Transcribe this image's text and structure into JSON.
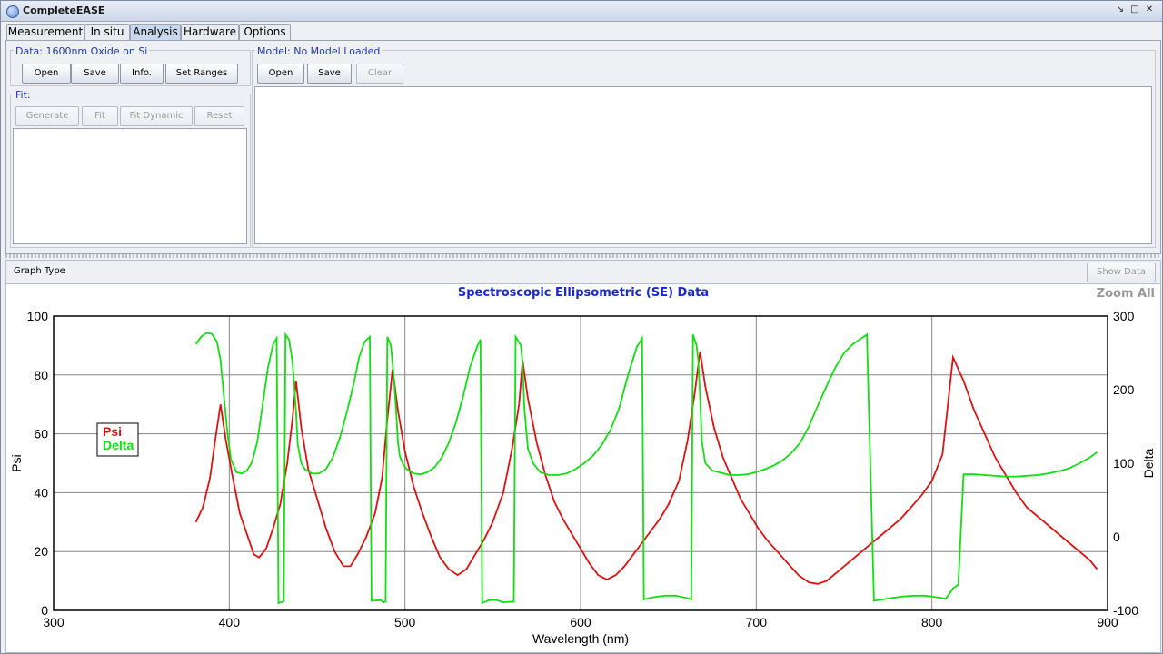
{
  "window": {
    "title": "CompleteEASE"
  },
  "tabs": [
    {
      "label": "Measurement",
      "active": false
    },
    {
      "label": "In situ",
      "active": false
    },
    {
      "label": "Analysis",
      "active": true
    },
    {
      "label": "Hardware",
      "active": false
    },
    {
      "label": "Options",
      "active": false
    }
  ],
  "data_group": {
    "title": "Data: 1600nm Oxide on Si",
    "buttons": {
      "open": "Open",
      "save": "Save",
      "info": "Info.",
      "set_ranges": "Set Ranges"
    }
  },
  "fit_group": {
    "title": "Fit:",
    "buttons": {
      "generate": "Generate",
      "fit": "Fit",
      "fit_dynamic": "Fit Dynamic",
      "reset": "Reset"
    }
  },
  "model_group": {
    "title": "Model: No Model Loaded",
    "buttons": {
      "open": "Open",
      "save": "Save",
      "clear": "Clear"
    }
  },
  "graph_bar": {
    "graph_type_label": "Graph Type",
    "show_data": "Show Data"
  },
  "graph": {
    "zoom_all": "Zoom All"
  },
  "colors": {
    "psi": "#e01010",
    "delta": "#10e010",
    "title": "#1a2ad0"
  },
  "chart_data": {
    "type": "line",
    "title": "Spectroscopic Ellipsometric (SE) Data",
    "xlabel": "Wavelength (nm)",
    "ylabel": "Psi",
    "y2label": "Delta",
    "xlim": [
      300,
      900
    ],
    "ylim": [
      0,
      100
    ],
    "y2lim": [
      -100,
      300
    ],
    "xticks": [
      "300",
      "400",
      "500",
      "600",
      "700",
      "800",
      "900"
    ],
    "yticks": [
      "0",
      "20",
      "40",
      "60",
      "80",
      "100"
    ],
    "y2ticks": [
      "-100",
      "0",
      "100",
      "200",
      "300"
    ],
    "grid": true,
    "legend_position": "left",
    "series": [
      {
        "name": "Psi",
        "axis": "left",
        "color": "#e01010",
        "points": [
          [
            381,
            30
          ],
          [
            385,
            35
          ],
          [
            389,
            45
          ],
          [
            392,
            58
          ],
          [
            395,
            70
          ],
          [
            398,
            58
          ],
          [
            402,
            45
          ],
          [
            406,
            33
          ],
          [
            410,
            26
          ],
          [
            414,
            19
          ],
          [
            417,
            18
          ],
          [
            421,
            21
          ],
          [
            425,
            28
          ],
          [
            429,
            36
          ],
          [
            433,
            50
          ],
          [
            436,
            65
          ],
          [
            438,
            78
          ],
          [
            441,
            62
          ],
          [
            445,
            48
          ],
          [
            450,
            38
          ],
          [
            455,
            28
          ],
          [
            460,
            20
          ],
          [
            465,
            15
          ],
          [
            469,
            15
          ],
          [
            473,
            19
          ],
          [
            478,
            25
          ],
          [
            483,
            33
          ],
          [
            487,
            45
          ],
          [
            490,
            65
          ],
          [
            493,
            82
          ],
          [
            496,
            68
          ],
          [
            500,
            54
          ],
          [
            505,
            42
          ],
          [
            510,
            33
          ],
          [
            515,
            25
          ],
          [
            520,
            18
          ],
          [
            525,
            14
          ],
          [
            530,
            12
          ],
          [
            535,
            14
          ],
          [
            540,
            19
          ],
          [
            545,
            24
          ],
          [
            550,
            30
          ],
          [
            556,
            40
          ],
          [
            561,
            55
          ],
          [
            565,
            70
          ],
          [
            567,
            85
          ],
          [
            570,
            72
          ],
          [
            575,
            57
          ],
          [
            580,
            46
          ],
          [
            585,
            37
          ],
          [
            590,
            31
          ],
          [
            595,
            26
          ],
          [
            600,
            21
          ],
          [
            605,
            16
          ],
          [
            610,
            12
          ],
          [
            615,
            10.5
          ],
          [
            620,
            12
          ],
          [
            625,
            15
          ],
          [
            630,
            19
          ],
          [
            635,
            23
          ],
          [
            640,
            27
          ],
          [
            645,
            31
          ],
          [
            650,
            36
          ],
          [
            656,
            44
          ],
          [
            661,
            58
          ],
          [
            665,
            74
          ],
          [
            668,
            88
          ],
          [
            671,
            76
          ],
          [
            676,
            62
          ],
          [
            681,
            52
          ],
          [
            686,
            45
          ],
          [
            691,
            38
          ],
          [
            696,
            33
          ],
          [
            701,
            28
          ],
          [
            706,
            24
          ],
          [
            712,
            20
          ],
          [
            718,
            16
          ],
          [
            724,
            12
          ],
          [
            730,
            9.5
          ],
          [
            735,
            9
          ],
          [
            740,
            10
          ],
          [
            746,
            13
          ],
          [
            752,
            16
          ],
          [
            758,
            19
          ],
          [
            764,
            22
          ],
          [
            770,
            25
          ],
          [
            776,
            28
          ],
          [
            782,
            31
          ],
          [
            788,
            35
          ],
          [
            794,
            39
          ],
          [
            800,
            44
          ],
          [
            806,
            53
          ],
          [
            812,
            86
          ],
          [
            818,
            78
          ],
          [
            824,
            68
          ],
          [
            830,
            60
          ],
          [
            836,
            52
          ],
          [
            842,
            46
          ],
          [
            848,
            40
          ],
          [
            854,
            35
          ],
          [
            860,
            32
          ],
          [
            866,
            29
          ],
          [
            872,
            26
          ],
          [
            878,
            23
          ],
          [
            884,
            20
          ],
          [
            890,
            17
          ],
          [
            894,
            14
          ]
        ]
      },
      {
        "name": "Delta",
        "axis": "right",
        "color": "#10e010",
        "points": [
          [
            381,
            262
          ],
          [
            384,
            272
          ],
          [
            387,
            277
          ],
          [
            390,
            276
          ],
          [
            393,
            265
          ],
          [
            395,
            240
          ],
          [
            397,
            190
          ],
          [
            399,
            140
          ],
          [
            401,
            105
          ],
          [
            404,
            88
          ],
          [
            407,
            86
          ],
          [
            410,
            90
          ],
          [
            413,
            102
          ],
          [
            416,
            130
          ],
          [
            419,
            180
          ],
          [
            422,
            230
          ],
          [
            425,
            262
          ],
          [
            427,
            270
          ],
          [
            428,
            -90
          ],
          [
            431,
            -88
          ],
          [
            432,
            275
          ],
          [
            434,
            268
          ],
          [
            436,
            238
          ],
          [
            437,
            205
          ],
          [
            438,
            170
          ],
          [
            439,
            125
          ],
          [
            441,
            100
          ],
          [
            443,
            92
          ],
          [
            447,
            86
          ],
          [
            451,
            86
          ],
          [
            455,
            92
          ],
          [
            459,
            108
          ],
          [
            463,
            135
          ],
          [
            467,
            170
          ],
          [
            471,
            210
          ],
          [
            474,
            245
          ],
          [
            477,
            265
          ],
          [
            480,
            272
          ],
          [
            481,
            -87
          ],
          [
            486,
            -86
          ],
          [
            488,
            -89
          ],
          [
            489,
            -88
          ],
          [
            490,
            272
          ],
          [
            492,
            260
          ],
          [
            493,
            235
          ],
          [
            494,
            205
          ],
          [
            495,
            170
          ],
          [
            496,
            130
          ],
          [
            497,
            110
          ],
          [
            499,
            98
          ],
          [
            501,
            92
          ],
          [
            505,
            86
          ],
          [
            509,
            85
          ],
          [
            513,
            88
          ],
          [
            517,
            95
          ],
          [
            521,
            108
          ],
          [
            525,
            128
          ],
          [
            529,
            155
          ],
          [
            533,
            190
          ],
          [
            537,
            230
          ],
          [
            541,
            258
          ],
          [
            543,
            268
          ],
          [
            544,
            -90
          ],
          [
            548,
            -86
          ],
          [
            552,
            -86
          ],
          [
            556,
            -89
          ],
          [
            562,
            -88
          ],
          [
            563,
            272
          ],
          [
            566,
            260
          ],
          [
            567,
            235
          ],
          [
            568,
            175
          ],
          [
            570,
            120
          ],
          [
            573,
            100
          ],
          [
            577,
            88
          ],
          [
            582,
            84
          ],
          [
            587,
            84
          ],
          [
            592,
            86
          ],
          [
            597,
            92
          ],
          [
            602,
            100
          ],
          [
            607,
            110
          ],
          [
            612,
            125
          ],
          [
            617,
            145
          ],
          [
            622,
            175
          ],
          [
            627,
            220
          ],
          [
            632,
            258
          ],
          [
            635,
            270
          ],
          [
            636,
            -85
          ],
          [
            642,
            -82
          ],
          [
            648,
            -80
          ],
          [
            654,
            -80
          ],
          [
            660,
            -83
          ],
          [
            663,
            -85
          ],
          [
            664,
            275
          ],
          [
            666,
            260
          ],
          [
            667,
            240
          ],
          [
            668,
            190
          ],
          [
            669,
            130
          ],
          [
            671,
            100
          ],
          [
            675,
            90
          ],
          [
            680,
            87
          ],
          [
            685,
            84
          ],
          [
            690,
            84
          ],
          [
            695,
            85
          ],
          [
            700,
            88
          ],
          [
            705,
            92
          ],
          [
            710,
            97
          ],
          [
            715,
            104
          ],
          [
            720,
            114
          ],
          [
            725,
            128
          ],
          [
            730,
            150
          ],
          [
            735,
            178
          ],
          [
            740,
            205
          ],
          [
            745,
            230
          ],
          [
            750,
            250
          ],
          [
            755,
            262
          ],
          [
            760,
            270
          ],
          [
            763,
            275
          ],
          [
            767,
            -87
          ],
          [
            772,
            -85
          ],
          [
            778,
            -83
          ],
          [
            784,
            -81
          ],
          [
            790,
            -80
          ],
          [
            796,
            -80
          ],
          [
            802,
            -82
          ],
          [
            808,
            -84
          ],
          [
            812,
            -70
          ],
          [
            815,
            -65
          ],
          [
            818,
            85
          ],
          [
            824,
            85
          ],
          [
            830,
            84
          ],
          [
            836,
            83
          ],
          [
            842,
            82
          ],
          [
            848,
            82
          ],
          [
            854,
            83
          ],
          [
            860,
            84
          ],
          [
            866,
            86
          ],
          [
            872,
            89
          ],
          [
            878,
            93
          ],
          [
            884,
            100
          ],
          [
            890,
            108
          ],
          [
            894,
            115
          ]
        ]
      }
    ]
  }
}
